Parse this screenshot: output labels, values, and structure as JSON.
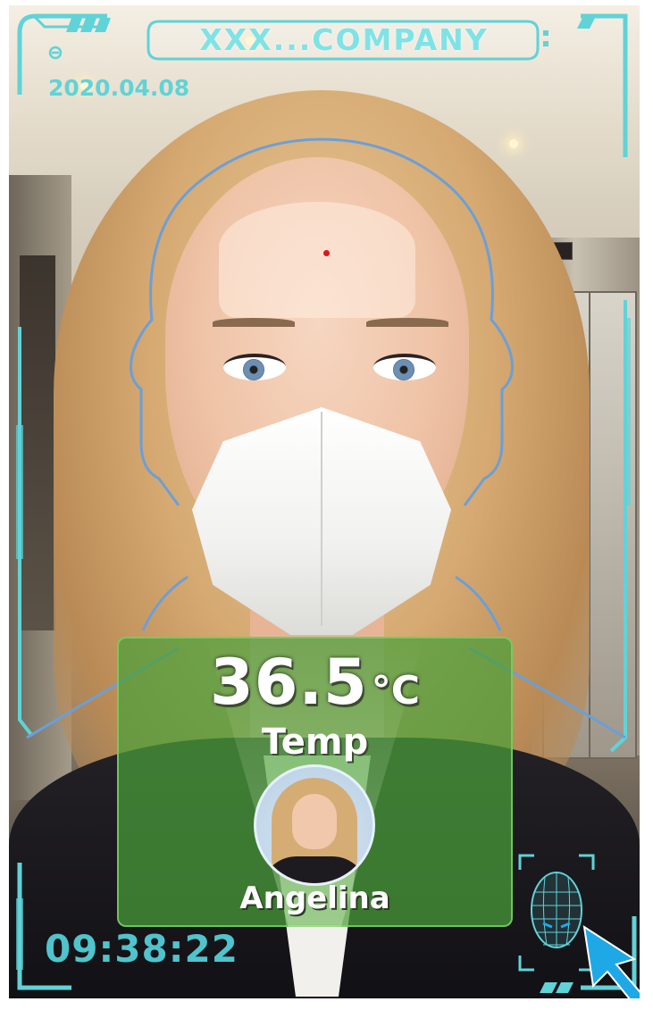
{
  "header": {
    "company": "XXX...COMPANY",
    "date": "2020.04.08"
  },
  "measurement": {
    "temperature_value": "36.5",
    "temperature_unit": "°C",
    "temperature_label": "Temp"
  },
  "person": {
    "name": "Angelina"
  },
  "footer": {
    "time": "09:38:22"
  },
  "colors": {
    "hud_cyan": "#5fd3d8",
    "panel_green": "#4aa03a",
    "head_outline_blue": "#6b9fd8",
    "cursor_blue": "#1fa8e6"
  },
  "icons": [
    "face-scan-icon",
    "cursor-arrow-icon",
    "minus-circle-icon"
  ]
}
